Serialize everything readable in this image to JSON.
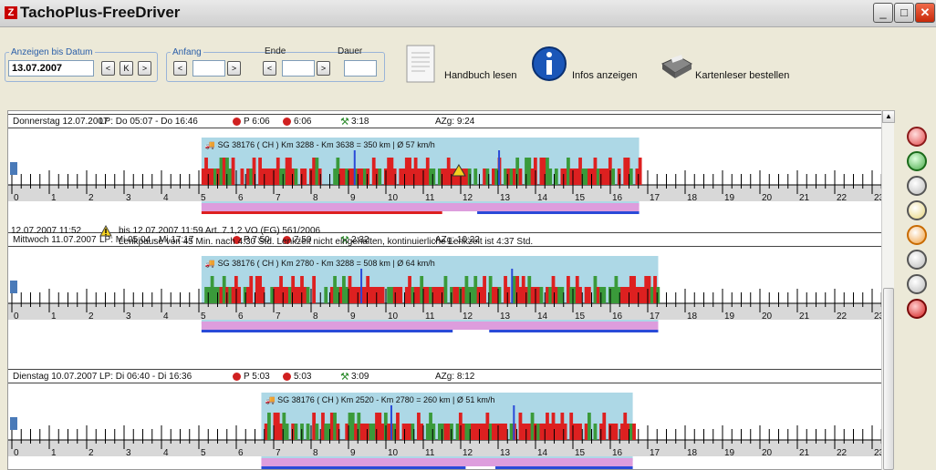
{
  "window": {
    "title": "TachoPlus-FreeDriver"
  },
  "toolbar": {
    "date_group": {
      "legend": "Anzeigen bis Datum",
      "value": "13.07.2007",
      "btn_prev": "<",
      "btn_k": "K",
      "btn_next": ">"
    },
    "anfang_group": {
      "legend": "Anfang"
    },
    "ende_label": "Ende",
    "dauer_label": "Dauer",
    "handbook": "Handbuch lesen",
    "info": "Infos anzeigen",
    "cardreader": "Kartenleser bestellen"
  },
  "colors": {
    "driving": "#dd2020",
    "work": "#3a9a3a",
    "rest_bg": "#add8e6",
    "pink": "#dd9ddd",
    "blue": "#2a4ad8"
  },
  "days": [
    {
      "header": "Donnerstag 12.07.2007",
      "lp": "LP: Do 05:07 - Do 16:46",
      "p": "P 6:06",
      "q": "6:06",
      "w": "3:18",
      "azg": "AZg: 9:24",
      "vehicle": "SG 38176 ( CH ) Km 3288 - Km 3638 = 350 km | Ø 57 km/h",
      "start_h": 5.07,
      "end_h": 16.77
    },
    {
      "header": "Mittwoch 11.07.2007",
      "lp": "LP: Mi 05:04 - Mi 17:17",
      "p": "P 7:50",
      "q": "7:50",
      "w": "2:32",
      "azg": "AZg: 10:22",
      "vehicle": "SG 38176 ( CH ) Km 2780 - Km 3288 = 508 km | Ø 64 km/h",
      "start_h": 5.07,
      "end_h": 17.28
    },
    {
      "header": "Dienstag 10.07.2007",
      "lp": "LP: Di 06:40 - Di 16:36",
      "p": "P 5:03",
      "q": "5:03",
      "w": "3:09",
      "azg": "AZg: 8:12",
      "vehicle": "SG 38176 ( CH ) Km 2520 - Km 2780 = 260 km | Ø 51 km/h",
      "start_h": 6.67,
      "end_h": 16.6
    }
  ],
  "warning": {
    "time": "12.07.2007 11:52",
    "line1": "bis 12.07.2007 11:59  Art. 7.1,2 VO (EG) 561/2006",
    "line2": "Lenkpause von 45 Min. nach 4:30 Std. Lenkzeit nicht eingehalten, kontinuierliche Lenkzeit ist 4:37 Std."
  },
  "hour_labels": [
    "0",
    "1",
    "2",
    "3",
    "4",
    "5",
    "6",
    "7",
    "8",
    "9",
    "10",
    "11",
    "12",
    "13",
    "14",
    "15",
    "16",
    "17",
    "18",
    "19",
    "20",
    "21",
    "22",
    "23"
  ]
}
